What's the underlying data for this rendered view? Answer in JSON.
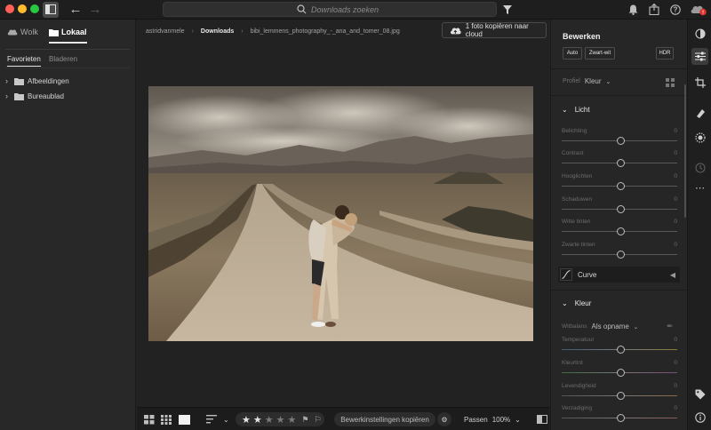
{
  "search": {
    "placeholder": "Downloads zoeken"
  },
  "sidebar": {
    "sources": [
      {
        "label": "Wolk"
      },
      {
        "label": "Lokaal"
      }
    ],
    "subtabs": [
      {
        "label": "Favorieten"
      },
      {
        "label": "Bladeren"
      }
    ],
    "folders": [
      {
        "label": "Afbeeldingen"
      },
      {
        "label": "Bureaublad"
      }
    ]
  },
  "breadcrumb": {
    "root": "astridvanmele",
    "folder": "Downloads",
    "file": "bibi_lemmens_photography_-_ana_and_tomer_08.jpg"
  },
  "copy_cloud": {
    "label": "1 foto kopiëren naar cloud"
  },
  "bottombar": {
    "rating": 2,
    "rating_max": 5,
    "copy_settings_label": "Bewerkinstellingen kopiëren",
    "fit_label": "Passen",
    "zoom": "100%"
  },
  "edit": {
    "title": "Bewerken",
    "buttons": {
      "auto": "Auto",
      "bw": "Zwart-wit",
      "hdr": "HDR"
    },
    "profile_label": "Profiel",
    "profile_value": "Kleur",
    "light": {
      "title": "Licht",
      "sliders": [
        {
          "label": "Belichting",
          "value": "0"
        },
        {
          "label": "Contrast",
          "value": "0"
        },
        {
          "label": "Hooglichten",
          "value": "0"
        },
        {
          "label": "Schaduwen",
          "value": "0"
        },
        {
          "label": "Witte tinten",
          "value": "0"
        },
        {
          "label": "Zwarte tinten",
          "value": "0"
        }
      ]
    },
    "curve_label": "Curve",
    "color": {
      "title": "Kleur",
      "wb_label": "Witbalans",
      "wb_value": "Als opname",
      "sliders": [
        {
          "label": "Temperatuur",
          "value": "0"
        },
        {
          "label": "Kleurtint",
          "value": "0"
        },
        {
          "label": "Levendigheid",
          "value": "0"
        },
        {
          "label": "Verzadiging",
          "value": "0"
        }
      ]
    }
  }
}
